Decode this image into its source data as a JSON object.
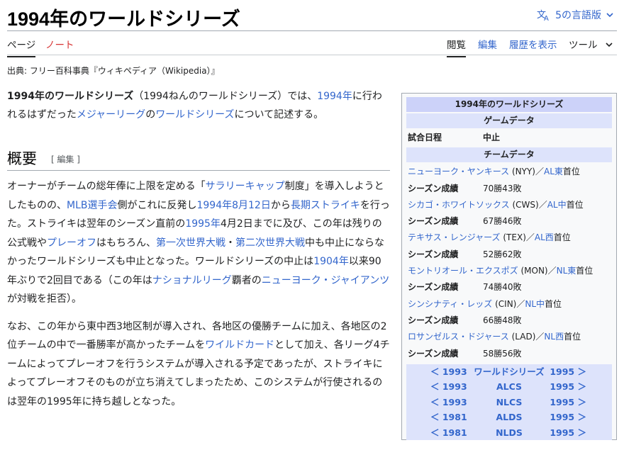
{
  "header": {
    "title": "1994年のワールドシリーズ",
    "lang_label": "5の言語版"
  },
  "tabs": {
    "page": "ページ",
    "talk": "ノート",
    "read": "閲覧",
    "edit": "編集",
    "history": "履歴を表示",
    "tools": "ツール"
  },
  "from": "出典: フリー百科事典『ウィキペディア（Wikipedia）』",
  "intro": {
    "bold": "1994年のワールドシリーズ",
    "t1": "（1994ねんのワールドシリーズ）では、",
    "l1": "1994年",
    "t2": "に行われるはずだった",
    "l2": "メジャーリーグ",
    "t3": "の",
    "l3": "ワールドシリーズ",
    "t4": "について記述する。"
  },
  "section": {
    "title": "概要",
    "edit_label": "[ 編集 ]"
  },
  "para1": {
    "t1": "オーナーがチームの総年俸に上限を定める「",
    "l1": "サラリーキャップ",
    "t2": "制度」を導入しようとしたものの、",
    "l2": "MLB選手会",
    "t3": "側がこれに反発し",
    "l3": "1994年8月12日",
    "t4": "から",
    "l4": "長期ストライキ",
    "t5": "を行った。ストライキは翌年のシーズン直前の",
    "l5": "1995年",
    "t6": "4月2日までに及び、この年は残りの公式戦や",
    "l6": "プレーオフ",
    "t7": "はもちろん、",
    "l7": "第一次世界大戦",
    "t8": "・",
    "l8": "第二次世界大戦",
    "t9": "中も中止にならなかったワールドシリーズも中止となった。ワールドシリーズの中止は",
    "l9": "1904年",
    "t10": "以来90年ぶりで2回目である（この年は",
    "l10": "ナショナルリーグ",
    "t11": "覇者の",
    "l11": "ニューヨーク・ジャイアンツ",
    "t12": "が対戦を拒否）。"
  },
  "para2": {
    "t1": "なお、この年から東中西3地区制が導入され、各地区の優勝チームに加え、各地区の2位チームの中で一番勝率が高かったチームを",
    "l1": "ワイルドカード",
    "t2": "として加え、各リーグ4チームによってプレーオフを行うシステムが導入される予定であったが、ストライキによってプレーオフそのものが立ち消えてしまったため、このシステムが行使されるのは翌年の1995年に持ち越しとなった。"
  },
  "infobox": {
    "title": "1994年のワールドシリーズ",
    "game_header": "ゲームデータ",
    "schedule_label": "試合日程",
    "schedule_value": "中止",
    "team_header": "チームデータ",
    "season_label": "シーズン成績",
    "teams": [
      {
        "name": "ニューヨーク・ヤンキース",
        "abbr": " (NYY)／",
        "div": "AL東",
        "rank": "首位",
        "record": "70勝43敗"
      },
      {
        "name": "シカゴ・ホワイトソックス",
        "abbr": " (CWS)／",
        "div": "AL中",
        "rank": "首位",
        "record": "67勝46敗"
      },
      {
        "name": "テキサス・レンジャーズ",
        "abbr": " (TEX)／",
        "div": "AL西",
        "rank": "首位",
        "record": "52勝62敗"
      },
      {
        "name": "モントリオール・エクスポズ",
        "abbr": " (MON)／",
        "div": "NL東",
        "rank": "首位",
        "record": "74勝40敗"
      },
      {
        "name": "シンシナティ・レッズ",
        "abbr": " (CIN)／",
        "div": "NL中",
        "rank": "首位",
        "record": "66勝48敗"
      },
      {
        "name": "ロサンゼルス・ドジャース",
        "abbr": " (LAD)／",
        "div": "NL西",
        "rank": "首位",
        "record": "58勝56敗"
      }
    ],
    "nav": [
      {
        "prev": "＜ 1993",
        "mid": "ワールドシリーズ",
        "next": "1995 ＞"
      },
      {
        "prev": "＜ 1993",
        "mid": "ALCS",
        "next": "1995 ＞"
      },
      {
        "prev": "＜ 1993",
        "mid": "NLCS",
        "next": "1995 ＞"
      },
      {
        "prev": "＜ 1981",
        "mid": "ALDS",
        "next": "1995 ＞"
      },
      {
        "prev": "＜ 1981",
        "mid": "NLDS",
        "next": "1995 ＞"
      }
    ]
  },
  "colors": {
    "link": "#3366cc",
    "talk": "#d73333",
    "infobox_header": "#ccd2f9"
  }
}
